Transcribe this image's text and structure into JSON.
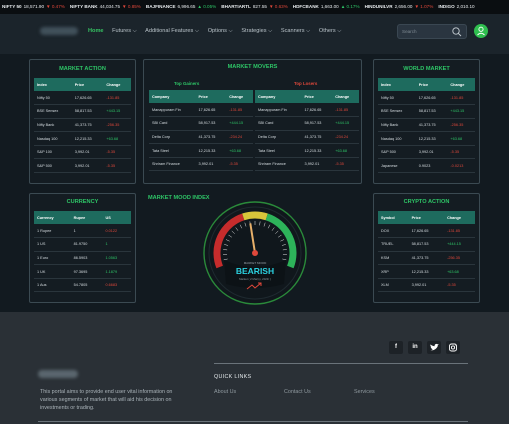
{
  "ticker": [
    {
      "name": "NIFTY 50",
      "price": "18,571.90",
      "change": "▼ 0.47%",
      "dir": "dn"
    },
    {
      "name": "NIFTY BANK",
      "price": "44,034.75",
      "change": "▼ 0.85%",
      "dir": "dn"
    },
    {
      "name": "BAJFINANCE",
      "price": "6,996.65",
      "change": "▲ 0.05%",
      "dir": "up"
    },
    {
      "name": "BHARTIARTL",
      "price": "827.55",
      "change": "▼ 0.63%",
      "dir": "dn"
    },
    {
      "name": "HDFCBANK",
      "price": "1,663.00",
      "change": "▲ 0.17%",
      "dir": "up"
    },
    {
      "name": "HINDUNILVR",
      "price": "2,656.00",
      "change": "▼ 1.07%",
      "dir": "dn"
    },
    {
      "name": "INDIGO",
      "price": "2,010.10",
      "change": "",
      "dir": "up"
    }
  ],
  "nav": {
    "items": [
      "Home",
      "Futures ⌵",
      "Additional Features ⌵",
      "Options ⌵",
      "Strategies ⌵",
      "Scanners ⌵",
      "Others ⌵"
    ],
    "search_placeholder": "Search"
  },
  "market_action": {
    "title": "MARKET ACTION",
    "headers": [
      "Index",
      "Price",
      "Change"
    ],
    "rows": [
      [
        "Nifty 50",
        "17,626.65",
        "-131.85",
        "dn"
      ],
      [
        "BSE Sensex",
        "58,817.53",
        "+443.15",
        "up"
      ],
      [
        "Nifty Bank",
        "41,373.75",
        "-256.35",
        "dn"
      ],
      [
        "Nasdaq 100",
        "12,215.33",
        "+63.68",
        "up"
      ],
      [
        "S&P 100",
        "3,992.01",
        "-5.35",
        "dn"
      ],
      [
        "S&P 500",
        "3,992.01",
        "-5.35",
        "dn"
      ]
    ]
  },
  "market_movers": {
    "title": "MARKET MOVERS",
    "gainers_label": "Top Gainers",
    "losers_label": "Top Losers",
    "headers": [
      "Company",
      "Price",
      "Change"
    ],
    "gainers": [
      [
        "Manappuram Fin",
        "17,626.65",
        "-131.85",
        "dn"
      ],
      [
        "SBI Card",
        "58,917.53",
        "+444.15",
        "up"
      ],
      [
        "Delta Corp",
        "41,373.75",
        "-234.24",
        "dn"
      ],
      [
        "Tata Steel",
        "12,215.33",
        "+63.68",
        "up"
      ],
      [
        "Shriram Finance",
        "3,992.01",
        "-5.35",
        "dn"
      ]
    ],
    "losers": [
      [
        "Manappuram Fin",
        "17,626.65",
        "-131.85",
        "dn"
      ],
      [
        "SBI Card",
        "58,917.53",
        "+444.15",
        "up"
      ],
      [
        "Delta Corp",
        "41,373.75",
        "-234.24",
        "dn"
      ],
      [
        "Tata Steel",
        "12,215.33",
        "+63.68",
        "up"
      ],
      [
        "Shriram Finance",
        "3,992.01",
        "-5.35",
        "dn"
      ]
    ]
  },
  "world_market": {
    "title": "WORLD MARKET",
    "headers": [
      "Index",
      "Price",
      "Change"
    ],
    "rows": [
      [
        "Nifty 50",
        "17,626.65",
        "-131.85",
        "dn"
      ],
      [
        "BSE Sensex",
        "58,817.53",
        "+443.15",
        "up"
      ],
      [
        "Nifty Bank",
        "41,373.75",
        "-256.35",
        "dn"
      ],
      [
        "Nasdaq 100",
        "12,215.33",
        "+63.68",
        "up"
      ],
      [
        "S&P 500",
        "3,992.01",
        "-5.35",
        "dn"
      ],
      [
        "Japanese",
        "0.9023",
        "-0.0213",
        "dn"
      ]
    ]
  },
  "currency": {
    "title": "CURRENCY",
    "headers": [
      "Currency",
      "Rupee",
      "US"
    ],
    "rows": [
      [
        "1 Rupee",
        "1",
        "0.0122",
        "dn"
      ],
      [
        "1 US",
        "81.9750",
        "1",
        "up"
      ],
      [
        "1 Euro",
        "86.5903",
        "1.0563",
        "up"
      ],
      [
        "1 UK",
        "97.3695",
        "1.1879",
        "up"
      ],
      [
        "1 Aus",
        "54.7805",
        "0.6683",
        "dn"
      ]
    ]
  },
  "mood": {
    "title": "MARKET MOOD INDEX",
    "label": "MARKET MOOD",
    "value_text": "BEARISH",
    "updated": "Market ( 2 Mar(s), 2023/ )",
    "level": 0.45
  },
  "crypto": {
    "title": "CRYPTO ACTION",
    "headers": [
      "Symbol",
      "Price",
      "Change"
    ],
    "rows": [
      [
        "DOX",
        "17,626.65",
        "-131.85",
        "dn"
      ],
      [
        "TRUEL",
        "58,817.53",
        "+444.15",
        "up"
      ],
      [
        "KSM",
        "41,373.75",
        "-256.35",
        "dn"
      ],
      [
        "XRP",
        "12,215.33",
        "+63.68",
        "up"
      ],
      [
        "XLM",
        "3,992.01",
        "-5.35",
        "dn"
      ]
    ]
  },
  "footer": {
    "social": [
      "f",
      "in",
      "t",
      "ig"
    ],
    "description": "This portal aims to provide end user vital information on various segments of market that will aid his decision on investments or trading.",
    "quick_links_title": "QUICK LINKS",
    "links": [
      "About Us",
      "Contact Us",
      "Services"
    ]
  },
  "colors": {
    "accent": "#2ec567",
    "down": "#e0483b",
    "header_row": "#1e6b5e"
  }
}
